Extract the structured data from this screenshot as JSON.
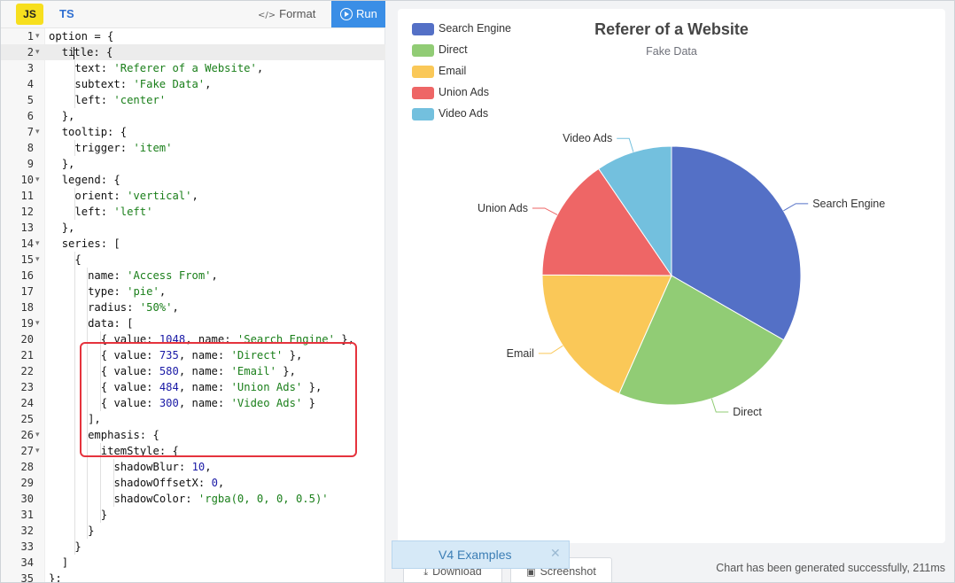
{
  "toolbar": {
    "js_tab": "JS",
    "ts_tab": "TS",
    "format_label": "Format",
    "format_icon": "</>",
    "run_label": "Run"
  },
  "code": {
    "active_line": 2,
    "lines": [
      {
        "n": "1",
        "fold": true,
        "indent": 0,
        "parts": [
          [
            "k",
            "option = {"
          ]
        ]
      },
      {
        "n": "2",
        "fold": true,
        "indent": 1,
        "parts": [
          [
            "k",
            "ti"
          ],
          [
            "cursor",
            ""
          ],
          [
            "k",
            "tle: {"
          ]
        ]
      },
      {
        "n": "3",
        "fold": false,
        "indent": 2,
        "parts": [
          [
            "k",
            "text: "
          ],
          [
            "s",
            "'Referer of a Website'"
          ],
          [
            "k",
            ","
          ]
        ]
      },
      {
        "n": "4",
        "fold": false,
        "indent": 2,
        "parts": [
          [
            "k",
            "subtext: "
          ],
          [
            "s",
            "'Fake Data'"
          ],
          [
            "k",
            ","
          ]
        ]
      },
      {
        "n": "5",
        "fold": false,
        "indent": 2,
        "parts": [
          [
            "k",
            "left: "
          ],
          [
            "s",
            "'center'"
          ]
        ]
      },
      {
        "n": "6",
        "fold": false,
        "indent": 1,
        "parts": [
          [
            "k",
            "},"
          ]
        ]
      },
      {
        "n": "7",
        "fold": true,
        "indent": 1,
        "parts": [
          [
            "k",
            "tooltip: {"
          ]
        ]
      },
      {
        "n": "8",
        "fold": false,
        "indent": 2,
        "parts": [
          [
            "k",
            "trigger: "
          ],
          [
            "s",
            "'item'"
          ]
        ]
      },
      {
        "n": "9",
        "fold": false,
        "indent": 1,
        "parts": [
          [
            "k",
            "},"
          ]
        ]
      },
      {
        "n": "10",
        "fold": true,
        "indent": 1,
        "parts": [
          [
            "k",
            "legend: {"
          ]
        ]
      },
      {
        "n": "11",
        "fold": false,
        "indent": 2,
        "parts": [
          [
            "k",
            "orient: "
          ],
          [
            "s",
            "'vertical'"
          ],
          [
            "k",
            ","
          ]
        ]
      },
      {
        "n": "12",
        "fold": false,
        "indent": 2,
        "parts": [
          [
            "k",
            "left: "
          ],
          [
            "s",
            "'left'"
          ]
        ]
      },
      {
        "n": "13",
        "fold": false,
        "indent": 1,
        "parts": [
          [
            "k",
            "},"
          ]
        ]
      },
      {
        "n": "14",
        "fold": true,
        "indent": 1,
        "parts": [
          [
            "k",
            "series: ["
          ]
        ]
      },
      {
        "n": "15",
        "fold": true,
        "indent": 2,
        "parts": [
          [
            "k",
            "{"
          ]
        ]
      },
      {
        "n": "16",
        "fold": false,
        "indent": 3,
        "parts": [
          [
            "k",
            "name: "
          ],
          [
            "s",
            "'Access From'"
          ],
          [
            "k",
            ","
          ]
        ]
      },
      {
        "n": "17",
        "fold": false,
        "indent": 3,
        "parts": [
          [
            "k",
            "type: "
          ],
          [
            "s",
            "'pie'"
          ],
          [
            "k",
            ","
          ]
        ]
      },
      {
        "n": "18",
        "fold": false,
        "indent": 3,
        "parts": [
          [
            "k",
            "radius: "
          ],
          [
            "s",
            "'50%'"
          ],
          [
            "k",
            ","
          ]
        ]
      },
      {
        "n": "19",
        "fold": true,
        "indent": 3,
        "parts": [
          [
            "k",
            "data: ["
          ]
        ]
      },
      {
        "n": "20",
        "fold": false,
        "indent": 4,
        "parts": [
          [
            "k",
            "{ value: "
          ],
          [
            "n",
            "1048"
          ],
          [
            "k",
            ", name: "
          ],
          [
            "s",
            "'Search Engine'"
          ],
          [
            "k",
            " },"
          ]
        ]
      },
      {
        "n": "21",
        "fold": false,
        "indent": 4,
        "parts": [
          [
            "k",
            "{ value: "
          ],
          [
            "n",
            "735"
          ],
          [
            "k",
            ", name: "
          ],
          [
            "s",
            "'Direct'"
          ],
          [
            "k",
            " },"
          ]
        ]
      },
      {
        "n": "22",
        "fold": false,
        "indent": 4,
        "parts": [
          [
            "k",
            "{ value: "
          ],
          [
            "n",
            "580"
          ],
          [
            "k",
            ", name: "
          ],
          [
            "s",
            "'Email'"
          ],
          [
            "k",
            " },"
          ]
        ]
      },
      {
        "n": "23",
        "fold": false,
        "indent": 4,
        "parts": [
          [
            "k",
            "{ value: "
          ],
          [
            "n",
            "484"
          ],
          [
            "k",
            ", name: "
          ],
          [
            "s",
            "'Union Ads'"
          ],
          [
            "k",
            " },"
          ]
        ]
      },
      {
        "n": "24",
        "fold": false,
        "indent": 4,
        "parts": [
          [
            "k",
            "{ value: "
          ],
          [
            "n",
            "300"
          ],
          [
            "k",
            ", name: "
          ],
          [
            "s",
            "'Video Ads'"
          ],
          [
            "k",
            " }"
          ]
        ]
      },
      {
        "n": "25",
        "fold": false,
        "indent": 3,
        "parts": [
          [
            "k",
            "],"
          ]
        ]
      },
      {
        "n": "26",
        "fold": true,
        "indent": 3,
        "parts": [
          [
            "k",
            "emphasis: {"
          ]
        ]
      },
      {
        "n": "27",
        "fold": true,
        "indent": 4,
        "parts": [
          [
            "k",
            "itemStyle: {"
          ]
        ]
      },
      {
        "n": "28",
        "fold": false,
        "indent": 5,
        "parts": [
          [
            "k",
            "shadowBlur: "
          ],
          [
            "n",
            "10"
          ],
          [
            "k",
            ","
          ]
        ]
      },
      {
        "n": "29",
        "fold": false,
        "indent": 5,
        "parts": [
          [
            "k",
            "shadowOffsetX: "
          ],
          [
            "n",
            "0"
          ],
          [
            "k",
            ","
          ]
        ]
      },
      {
        "n": "30",
        "fold": false,
        "indent": 5,
        "parts": [
          [
            "k",
            "shadowColor: "
          ],
          [
            "s",
            "'rgba(0, 0, 0, 0.5)'"
          ]
        ]
      },
      {
        "n": "31",
        "fold": false,
        "indent": 4,
        "parts": [
          [
            "k",
            "}"
          ]
        ]
      },
      {
        "n": "32",
        "fold": false,
        "indent": 3,
        "parts": [
          [
            "k",
            "}"
          ]
        ]
      },
      {
        "n": "33",
        "fold": false,
        "indent": 2,
        "parts": [
          [
            "k",
            "}"
          ]
        ]
      },
      {
        "n": "34",
        "fold": false,
        "indent": 1,
        "parts": [
          [
            "k",
            "]"
          ]
        ]
      },
      {
        "n": "35",
        "fold": false,
        "indent": 0,
        "parts": [
          [
            "k",
            "};"
          ]
        ]
      }
    ]
  },
  "chart_data": {
    "type": "pie",
    "title": "Referer of a Website",
    "subtitle": "Fake Data",
    "legend_position": "top-left",
    "series": [
      {
        "name": "Access From",
        "data": [
          {
            "name": "Search Engine",
            "value": 1048,
            "color": "#5470c6"
          },
          {
            "name": "Direct",
            "value": 735,
            "color": "#91cc75"
          },
          {
            "name": "Email",
            "value": 580,
            "color": "#fac858"
          },
          {
            "name": "Union Ads",
            "value": 484,
            "color": "#ee6666"
          },
          {
            "name": "Video Ads",
            "value": 300,
            "color": "#73c0de"
          }
        ]
      }
    ]
  },
  "bottom": {
    "download_label": "Download",
    "screenshot_label": "Screenshot",
    "status": "Chart has been generated successfully, 211ms"
  },
  "toast": {
    "label": "V4 Examples",
    "close_icon": "close-icon"
  },
  "icons": {
    "run": "play-circle-icon",
    "format": "code-icon",
    "download": "download-icon",
    "screenshot": "camera-icon"
  },
  "colors": {
    "run_button": "#3a8ee6",
    "highlight_box": "#e5333d",
    "js_badge": "#f7df1e"
  }
}
